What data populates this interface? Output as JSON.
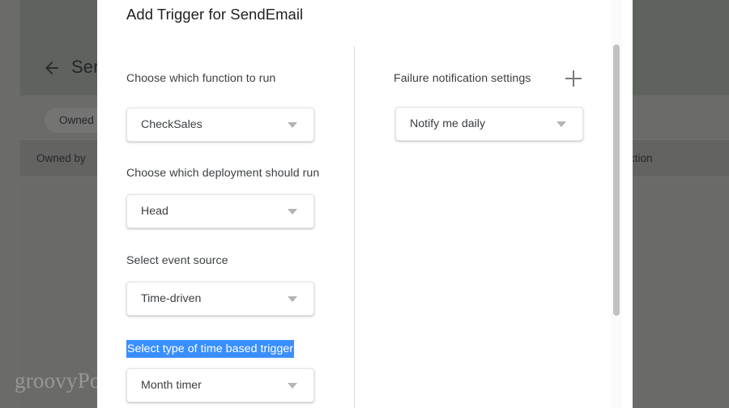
{
  "background": {
    "app_title": "Ser",
    "back_icon": "arrow-left-icon",
    "filter_chip": "Owned b",
    "table_headers": {
      "owned_by": "Owned by",
      "function": "unction"
    },
    "watermark": "groovyPost.com"
  },
  "modal": {
    "title": "Add Trigger for SendEmail",
    "left_column": {
      "fields": [
        {
          "label": "Choose which function to run",
          "value": "CheckSales",
          "selected": false
        },
        {
          "label": "Choose which deployment should run",
          "value": "Head",
          "selected": false
        },
        {
          "label": "Select event source",
          "value": "Time-driven",
          "selected": false
        },
        {
          "label": "Select type of time based trigger",
          "value": "Month timer",
          "selected": true
        }
      ]
    },
    "right_column": {
      "label": "Failure notification settings",
      "add_icon": "plus-icon",
      "value": "Notify me daily"
    },
    "colors": {
      "selection_blue": "#3a8fff",
      "text_primary": "#202124",
      "text_secondary": "#3c4043",
      "scrollbar_thumb": "#c1c1c1"
    }
  }
}
